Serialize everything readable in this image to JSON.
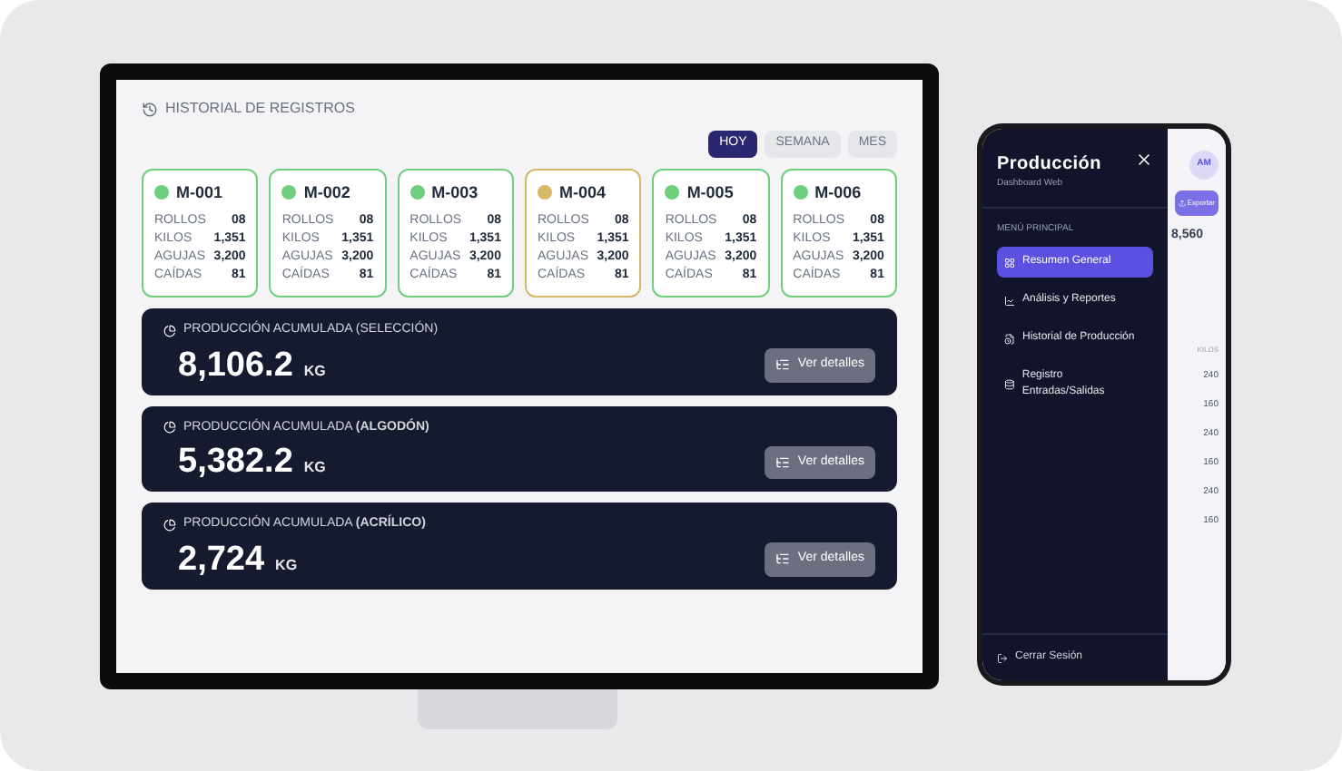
{
  "desktop": {
    "section_title": "HISTORIAL DE REGISTROS",
    "periods": [
      {
        "label": "HOY",
        "selected": true
      },
      {
        "label": "SEMANA",
        "selected": false
      },
      {
        "label": "MES",
        "selected": false
      }
    ],
    "machines": [
      {
        "name": "M-001",
        "color": "#6fcf7f",
        "stats": [
          [
            "ROLLOS",
            "08"
          ],
          [
            "KILOS",
            "1,351"
          ],
          [
            "AGUJAS",
            "3,200"
          ],
          [
            "CAÍDAS",
            "81"
          ]
        ]
      },
      {
        "name": "M-002",
        "color": "#6fcf7f",
        "stats": [
          [
            "ROLLOS",
            "08"
          ],
          [
            "KILOS",
            "1,351"
          ],
          [
            "AGUJAS",
            "3,200"
          ],
          [
            "CAÍDAS",
            "81"
          ]
        ]
      },
      {
        "name": "M-003",
        "color": "#6fcf7f",
        "stats": [
          [
            "ROLLOS",
            "08"
          ],
          [
            "KILOS",
            "1,351"
          ],
          [
            "AGUJAS",
            "3,200"
          ],
          [
            "CAÍDAS",
            "81"
          ]
        ]
      },
      {
        "name": "M-004",
        "color": "#d4b96a",
        "stats": [
          [
            "ROLLOS",
            "08"
          ],
          [
            "KILOS",
            "1,351"
          ],
          [
            "AGUJAS",
            "3,200"
          ],
          [
            "CAÍDAS",
            "81"
          ]
        ]
      },
      {
        "name": "M-005",
        "color": "#6fcf7f",
        "stats": [
          [
            "ROLLOS",
            "08"
          ],
          [
            "KILOS",
            "1,351"
          ],
          [
            "AGUJAS",
            "3,200"
          ],
          [
            "CAÍDAS",
            "81"
          ]
        ]
      },
      {
        "name": "M-006",
        "color": "#6fcf7f",
        "stats": [
          [
            "ROLLOS",
            "08"
          ],
          [
            "KILOS",
            "1,351"
          ],
          [
            "AGUJAS",
            "3,200"
          ],
          [
            "CAÍDAS",
            "81"
          ]
        ]
      }
    ],
    "totals": [
      {
        "label": "PRODUCCIÓN ACUMULADA (SELECCIÓN)",
        "value": "8,106.2",
        "unit": "KG",
        "button": "Ver detalles"
      },
      {
        "label": "PRODUCCIÓN ACUMULADA **(ALGODÓN)**",
        "value": "5,382.2",
        "unit": "KG",
        "button": "Ver detalles"
      },
      {
        "label": "PRODUCCIÓN ACUMULADA **(ACRÍLICO)**",
        "value": "2,724",
        "unit": "KG",
        "button": "Ver detalles"
      }
    ]
  },
  "phone": {
    "title": "Producción",
    "subtitle": "Dashboard Web",
    "section": "MENÚ PRINCIPAL",
    "menu": [
      {
        "label": "Resumen General",
        "selected": true
      },
      {
        "label": "Análisis y Reportes",
        "selected": false
      },
      {
        "label": "Historial de Producción",
        "selected": false
      },
      {
        "label": "Registro Entradas/Salidas",
        "selected": false
      }
    ],
    "logout": "Cerrar Sesión",
    "behind": {
      "avatar": "AM",
      "export": "Exportar",
      "value": "8,560",
      "column": "KILOS",
      "rows": [
        "240",
        "160",
        "240",
        "160",
        "240",
        "160"
      ]
    }
  }
}
